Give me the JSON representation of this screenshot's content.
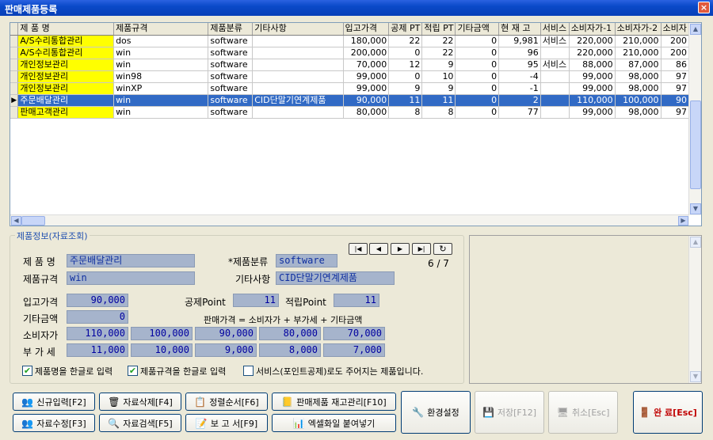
{
  "window": {
    "title": "판매제품등록",
    "close_label": "×"
  },
  "grid": {
    "columns": [
      "제 품 명",
      "제품규격",
      "제품분류",
      "기타사항",
      "입고가격",
      "공제 PT",
      "적립 PT",
      "기타금액",
      "현 재 고",
      "서비스",
      "소비자가-1",
      "소비자가-2",
      "소비자"
    ],
    "rows": [
      {
        "cells": [
          "A/S수리통합관리",
          "dos",
          "software",
          "",
          "180,000",
          "22",
          "22",
          "0",
          "9,981",
          "서비스",
          "220,000",
          "210,000",
          "200"
        ],
        "selected": false
      },
      {
        "cells": [
          "A/S수리통합관리",
          "win",
          "software",
          "",
          "200,000",
          "0",
          "22",
          "0",
          "96",
          "",
          "220,000",
          "210,000",
          "200"
        ],
        "selected": false
      },
      {
        "cells": [
          "개인정보관리",
          "win",
          "software",
          "",
          "70,000",
          "12",
          "9",
          "0",
          "95",
          "서비스",
          "88,000",
          "87,000",
          "86"
        ],
        "selected": false
      },
      {
        "cells": [
          "개인정보관리",
          "win98",
          "software",
          "",
          "99,000",
          "0",
          "10",
          "0",
          "-4",
          "",
          "99,000",
          "98,000",
          "97"
        ],
        "selected": false
      },
      {
        "cells": [
          "개인정보관리",
          "winXP",
          "software",
          "",
          "99,000",
          "9",
          "9",
          "0",
          "-1",
          "",
          "99,000",
          "98,000",
          "97"
        ],
        "selected": false
      },
      {
        "cells": [
          "주문배달관리",
          "win",
          "software",
          "CID단말기연계제품",
          "90,000",
          "11",
          "11",
          "0",
          "2",
          "",
          "110,000",
          "100,000",
          "90"
        ],
        "selected": true
      },
      {
        "cells": [
          "판매고객관리",
          "win",
          "software",
          "",
          "80,000",
          "8",
          "8",
          "0",
          "77",
          "",
          "99,000",
          "98,000",
          "97"
        ],
        "selected": false
      }
    ]
  },
  "info": {
    "legend": "제품정보(자료조회)",
    "product_name_label": "제 품 명",
    "product_name": "주문배달관리",
    "spec_label": "제품규격",
    "spec": "win",
    "category_label": "*제품분류",
    "category": "software",
    "etc_label": "기타사항",
    "etc": "CID단말기연계제품",
    "record_position": "6 / 7",
    "cost_label": "입고가격",
    "cost": "90,000",
    "deduct_label": "공제Point",
    "deduct": "11",
    "earn_label": "적립Point",
    "earn": "11",
    "other_amount_label": "기타금액",
    "other_amount": "0",
    "formula": "판매가격 = 소비자가 + 부가세 + 기타금액",
    "consumer_label": "소비자가",
    "consumer_prices": [
      "110,000",
      "100,000",
      "90,000",
      "80,000",
      "70,000"
    ],
    "vat_label": "부 가 세",
    "vat": [
      "11,000",
      "10,000",
      "9,000",
      "8,000",
      "7,000"
    ],
    "check1": "제품명을 한글로 입력",
    "check2": "제품규격을 한글로 입력",
    "check3": "서비스(포인트공제)로도 주어지는 제품입니다.",
    "check1_on": true,
    "check2_on": true,
    "check3_on": false
  },
  "nav": {
    "first": "|◀",
    "prev": "◀",
    "next": "▶",
    "last": "▶|",
    "refresh": "↻"
  },
  "buttons": {
    "new": "신규입력[F2]",
    "delete": "자료삭제[F4]",
    "sort": "정렬순서[F6]",
    "stock": "판매제품 재고관리[F10]",
    "settings": "환경설정",
    "save": "저장[F12]",
    "cancel": "취소[Esc]",
    "done": "완 료[Esc]",
    "edit": "자료수정[F3]",
    "search": "자료검색[F5]",
    "report": "보 고 서[F9]",
    "excel": "엑셀화일 붙여넣기"
  },
  "colors": {
    "selected_row": "#316ac5",
    "name_highlight": "#ffff00",
    "field_bg": "#a6b4cc",
    "title_bar": "#0a49c8"
  }
}
